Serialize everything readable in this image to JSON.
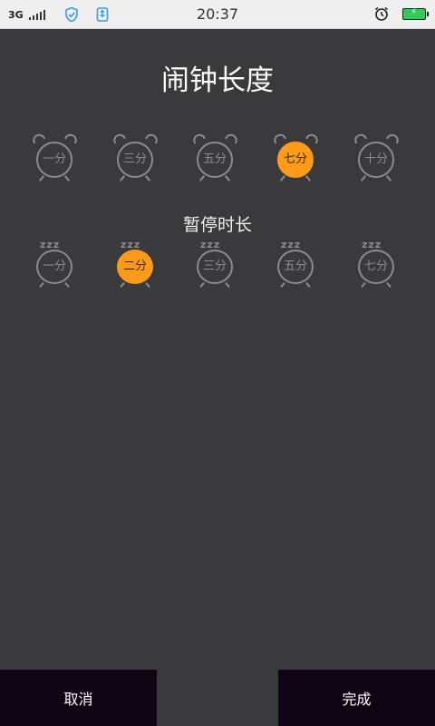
{
  "status_bar": {
    "network": "3G",
    "time": "20:37",
    "icons": [
      "signal-icon",
      "shield-icon",
      "usb-icon",
      "alarm-icon",
      "battery-charging-icon"
    ],
    "battery_color": "#34c759"
  },
  "page": {
    "title": "闹钟长度",
    "snooze_title": "暂停时长"
  },
  "alarm_lengths": [
    {
      "label": "一分",
      "selected": false
    },
    {
      "label": "三分",
      "selected": false
    },
    {
      "label": "五分",
      "selected": false
    },
    {
      "label": "七分",
      "selected": true
    },
    {
      "label": "十分",
      "selected": false
    }
  ],
  "snooze_lengths": [
    {
      "label": "一分",
      "selected": false
    },
    {
      "label": "二分",
      "selected": true
    },
    {
      "label": "三分",
      "selected": false
    },
    {
      "label": "五分",
      "selected": false
    },
    {
      "label": "七分",
      "selected": false
    }
  ],
  "buttons": {
    "cancel": "取消",
    "done": "完成"
  },
  "colors": {
    "background": "#3a3a3c",
    "accent": "#ff9b18",
    "button_bg": "#0e0413"
  }
}
